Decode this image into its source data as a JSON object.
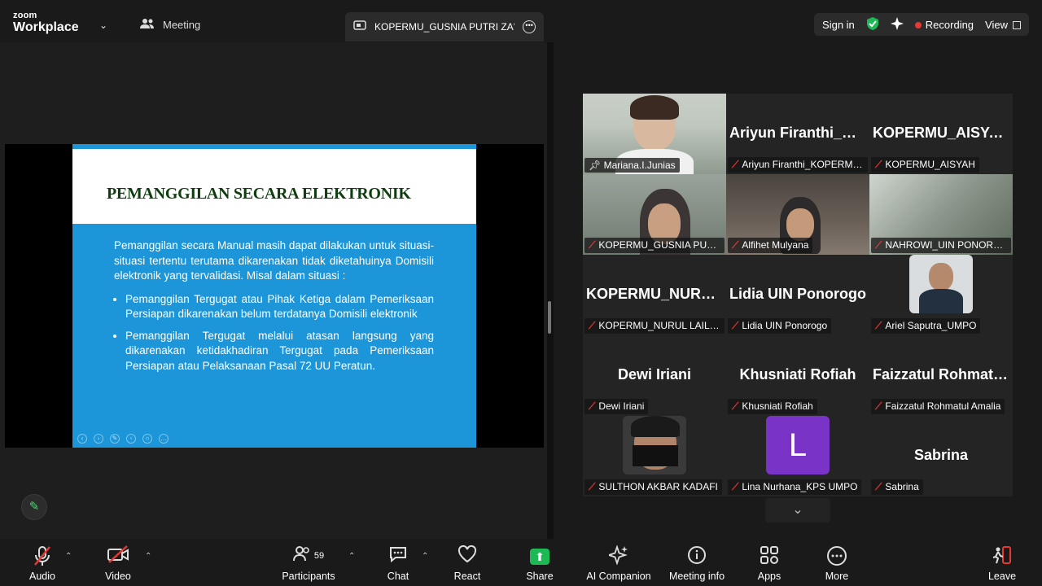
{
  "app": {
    "brand_small": "zoom",
    "brand_big": "Workplace"
  },
  "topbar": {
    "meeting_label": "Meeting",
    "share_tab": "KOPERMU_GUSNIA PUTRI ZA's sc",
    "sign_in": "Sign in",
    "recording": "Recording",
    "view": "View"
  },
  "slide": {
    "title": "PEMANGGILAN SECARA ELEKTRONIK",
    "intro": "Pemanggilan secara Manual masih dapat dilakukan untuk situasi-situasi tertentu terutama dikarenakan tidak diketahuinya Domisili elektronik yang tervalidasi. Misal dalam situasi :",
    "bullets": [
      "Pemanggilan Tergugat atau Pihak Ketiga dalam Pemeriksaan Persiapan dikarenakan belum terdatanya Domisili elektronik",
      "Pemanggilan Tergugat melalui atasan langsung yang dikarenakan ketidakhadiran Tergugat pada Pemeriksaan Persiapan atau Pelaksanaan Pasal 72 UU Peratun."
    ]
  },
  "participants_tiles": [
    {
      "label": "Mariana.I.Junias",
      "big": ""
    },
    {
      "label": "Ariyun Firanthi_KOPERMU_UNIM",
      "big": "Ariyun Firanthi_KOPERMU_UNIM"
    },
    {
      "label": "KOPERMU_AISYAH",
      "big": "KOPERMU_AISYAH"
    },
    {
      "label": "KOPERMU_GUSNIA PUTRI ZA",
      "big": ""
    },
    {
      "label": "Alfihet Mulyana",
      "big": ""
    },
    {
      "label": "NAHROWI_UIN PONOROGO",
      "big": ""
    },
    {
      "label": "KOPERMU_NURUL LAILATUL",
      "big": "KOPERMU_NURUL LAILATUL"
    },
    {
      "label": "Lidia UIN Ponorogo",
      "big": "Lidia UIN Ponorogo"
    },
    {
      "label": "Ariel Saputra_UMPO",
      "big": ""
    },
    {
      "label": "Dewi Iriani",
      "big": "Dewi Iriani"
    },
    {
      "label": "Khusniati Rofiah",
      "big": "Khusniati Rofiah"
    },
    {
      "label": "Faizzatul Rohmatul Amalia",
      "big": "Faizzatul Rohmatul Amalia"
    },
    {
      "label": "SULTHON AKBAR KADAFI",
      "big": ""
    },
    {
      "label": "Lina Nurhana_KPS UMPO",
      "big": ""
    },
    {
      "label": "Sabrina",
      "big": "Sabrina"
    }
  ],
  "avatar_letter": "L",
  "toolbar": {
    "audio": "Audio",
    "video": "Video",
    "participants": "Participants",
    "participants_count": "59",
    "chat": "Chat",
    "react": "React",
    "share": "Share",
    "ai": "AI Companion",
    "info": "Meeting info",
    "apps": "Apps",
    "more": "More",
    "leave": "Leave"
  }
}
